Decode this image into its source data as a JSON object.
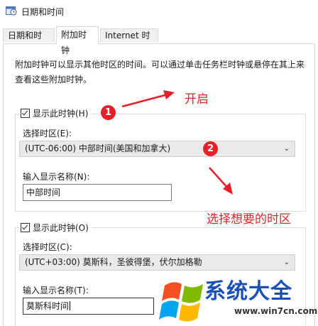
{
  "window": {
    "title": "日期和时间",
    "icon": "clock-calendar-icon"
  },
  "tabs": [
    {
      "label": "日期和时间",
      "active": false
    },
    {
      "label": "附加时钟",
      "active": true
    },
    {
      "label": "Internet 时间",
      "active": false
    }
  ],
  "description": "附加时钟可以显示其他时区的时间。可以通过单击任务栏时钟或悬停在其上来查看这些附加时钟。",
  "clock1": {
    "show_label": "显示此时钟(H)",
    "checked": true,
    "timezone_label": "选择时区(E):",
    "timezone_value": "(UTC-06:00) 中部时间(美国和加拿大)",
    "name_label": "输入显示名称(N):",
    "name_value": "中部时间"
  },
  "clock2": {
    "show_label": "显示此时钟(O)",
    "checked": true,
    "timezone_label": "选择时区(C):",
    "timezone_value": "(UTC+03:00) 莫斯科，圣彼得堡，伏尔加格勒",
    "name_label": "输入显示名称(T):",
    "name_value": "莫斯科时间"
  },
  "annotations": {
    "badge1": "❶",
    "badge2": "❷",
    "open_text": "开启",
    "choose_text": "选择想要的时区",
    "color": "#e5202a"
  },
  "watermark": {
    "text": "系统大全",
    "url": "www.win7cn.com",
    "logo": "windows-flag-logo"
  }
}
